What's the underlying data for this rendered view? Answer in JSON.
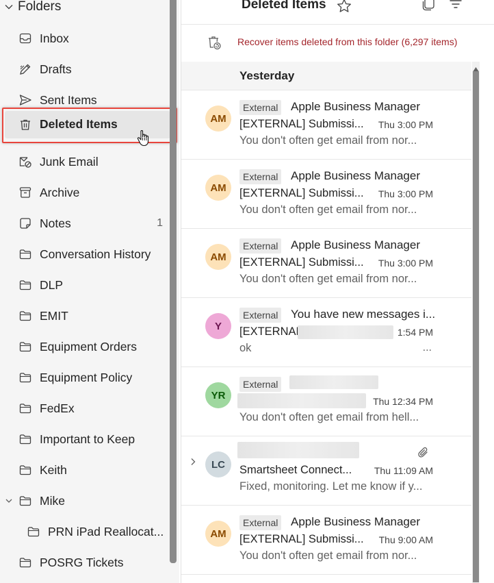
{
  "folder_pane": {
    "header": "Folders",
    "items": [
      {
        "label": "Inbox",
        "icon": "inbox-icon",
        "count": ""
      },
      {
        "label": "Drafts",
        "icon": "pencil-icon",
        "count": ""
      },
      {
        "label": "Sent Items",
        "icon": "send-icon",
        "count": ""
      },
      {
        "label": "Deleted Items",
        "icon": "trash-icon",
        "count": "",
        "selected": true
      },
      {
        "label": "Junk Email",
        "icon": "junk-icon",
        "count": ""
      },
      {
        "label": "Archive",
        "icon": "archive-icon",
        "count": ""
      },
      {
        "label": "Notes",
        "icon": "note-icon",
        "count": "1"
      },
      {
        "label": "Conversation History",
        "icon": "folder-icon",
        "count": ""
      },
      {
        "label": "DLP",
        "icon": "folder-icon",
        "count": ""
      },
      {
        "label": "EMIT",
        "icon": "folder-icon",
        "count": ""
      },
      {
        "label": "Equipment Orders",
        "icon": "folder-icon",
        "count": ""
      },
      {
        "label": "Equipment Policy",
        "icon": "folder-icon",
        "count": ""
      },
      {
        "label": "FedEx",
        "icon": "folder-icon",
        "count": ""
      },
      {
        "label": "Important to Keep",
        "icon": "folder-icon",
        "count": ""
      },
      {
        "label": "Keith",
        "icon": "folder-icon",
        "count": ""
      },
      {
        "label": "Mike",
        "icon": "folder-icon",
        "count": "",
        "expanded": true
      },
      {
        "label": "PRN iPad Reallocat...",
        "icon": "folder-icon",
        "count": "",
        "sub": true
      },
      {
        "label": "POSRG Tickets",
        "icon": "folder-icon",
        "count": ""
      }
    ]
  },
  "message_list": {
    "title": "Deleted Items",
    "recover_text": "Recover items deleted from this folder (6,297 items)",
    "group": "Yesterday",
    "messages": [
      {
        "initials": "AM",
        "avatar_bg": "#fde2b8",
        "avatar_fg": "#8a4a00",
        "tag": "External",
        "sender": "Apple Business Manager",
        "subject": "[EXTERNAL] Submissi...",
        "time": "Thu 3:00 PM",
        "preview": "You don't often get email from nor..."
      },
      {
        "initials": "AM",
        "avatar_bg": "#fde2b8",
        "avatar_fg": "#8a4a00",
        "tag": "External",
        "sender": "Apple Business Manager",
        "subject": "[EXTERNAL] Submissi...",
        "time": "Thu 3:00 PM",
        "preview": "You don't often get email from nor..."
      },
      {
        "initials": "AM",
        "avatar_bg": "#fde2b8",
        "avatar_fg": "#8a4a00",
        "tag": "External",
        "sender": "Apple Business Manager",
        "subject": "[EXTERNAL] Submissi...",
        "time": "Thu 3:00 PM",
        "preview": "You don't often get email from nor..."
      },
      {
        "initials": "Y",
        "avatar_bg": "#eea8d6",
        "avatar_fg": "#6b1450",
        "tag": "External",
        "sender": "You have new messages i...",
        "subject": "[EXTERNAL",
        "time": "1:54 PM",
        "preview": "ok",
        "preview_dots": "..."
      },
      {
        "initials": "YR",
        "avatar_bg": "#9fd89f",
        "avatar_fg": "#0b5a08",
        "tag": "External",
        "sender": "",
        "subject": "",
        "time": "Thu 12:34 PM",
        "preview": "You don't often get email from hell..."
      },
      {
        "initials": "LC",
        "avatar_bg": "#d2dbe0",
        "avatar_fg": "#3a4a55",
        "tag": "",
        "sender": "",
        "subject": "Smartsheet Connect...",
        "time": "Thu 11:09 AM",
        "preview": "Fixed, monitoring. Let me know if y..."
      },
      {
        "initials": "AM",
        "avatar_bg": "#fde2b8",
        "avatar_fg": "#8a4a00",
        "tag": "External",
        "sender": "Apple Business Manager",
        "subject": "[EXTERNAL] Submissi...",
        "time": "Thu 9:00 AM",
        "preview": "You don't often get email from nor..."
      }
    ]
  }
}
